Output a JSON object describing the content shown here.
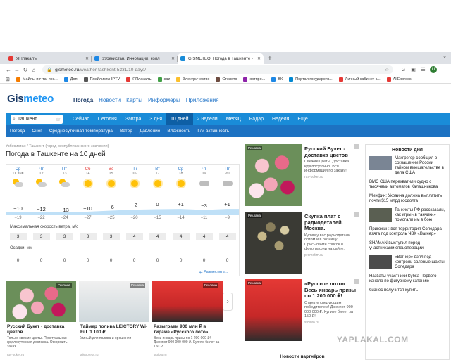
{
  "browser": {
    "tabs": [
      {
        "title": "ЯПлакалъ",
        "color": "#e53935"
      },
      {
        "title": "Узбекистан. Инновации. колл",
        "color": "#1e88e5"
      },
      {
        "title": "GISMETEO: Погода в Ташкенте -",
        "color": "#1a8cd8",
        "active": true
      }
    ],
    "new_tab": "+",
    "url_host": "gismeteo.ru",
    "url_path": "/weather-tashkent-5331/10-days/",
    "avatar": "U",
    "bookmarks": [
      {
        "label": "Майлы почта, пок...",
        "color": "#f57c00"
      },
      {
        "label": "Доп",
        "color": "#1e88e5"
      },
      {
        "label": "Плейлисты IPTV",
        "color": "#555"
      },
      {
        "label": "ЯПлакалъ",
        "color": "#e53935"
      },
      {
        "label": "saz",
        "color": "#43a047"
      },
      {
        "label": "Электричество",
        "color": "#fbc02d"
      },
      {
        "label": "Стелото",
        "color": "#6d4c41"
      },
      {
        "label": "хотпро...",
        "color": "#8e24aa"
      },
      {
        "label": "ВК",
        "color": "#1e88e5"
      },
      {
        "label": "Портал государств...",
        "color": "#0288d1"
      },
      {
        "label": "Личный кабинет к...",
        "color": "#e53935"
      },
      {
        "label": "AliExpress",
        "color": "#e53935"
      }
    ]
  },
  "site": {
    "logo_a": "Gis",
    "logo_b": "meteo",
    "topnav": [
      "Погода",
      "Новости",
      "Карты",
      "Информеры",
      "Приложения"
    ],
    "city": "Ташкент",
    "periods": [
      "Сейчас",
      "Сегодня",
      "Завтра",
      "3 дня",
      "10 дней",
      "2 недели",
      "Месяц",
      "Радар",
      "Неделя",
      "Ещё"
    ],
    "subnav": [
      "Погода",
      "Снег",
      "Среднесуточная температура",
      "Ветер",
      "Давление",
      "Влажность",
      "Г/м активность"
    ],
    "breadcrumb": "Узбекистан / Ташкент (город республиканского значения)",
    "title": "Погода в Ташкенте на 10 дней",
    "placement": "Разместить"
  },
  "forecast": {
    "days": [
      {
        "dn": "Ср",
        "dd": "11 янв",
        "icon": "pc",
        "max": "−10",
        "min": "−19",
        "wind": "3",
        "precip": "0"
      },
      {
        "dn": "Чт",
        "dd": "12",
        "icon": "pc",
        "max": "−12",
        "min": "−22",
        "wind": "3",
        "precip": "0"
      },
      {
        "dn": "Пт",
        "dd": "13",
        "icon": "pc",
        "max": "−13",
        "min": "−24",
        "wind": "3",
        "precip": "0"
      },
      {
        "dn": "Сб",
        "dd": "14",
        "icon": "sun",
        "max": "−10",
        "min": "−27",
        "wind": "3",
        "precip": "0",
        "weekend": true
      },
      {
        "dn": "Вс",
        "dd": "15",
        "icon": "sun",
        "max": "−6",
        "min": "−25",
        "wind": "3",
        "precip": "0",
        "weekend": true
      },
      {
        "dn": "Пн",
        "dd": "16",
        "icon": "sun",
        "max": "−2",
        "min": "−20",
        "wind": "4",
        "precip": "0"
      },
      {
        "dn": "Вт",
        "dd": "17",
        "icon": "sun",
        "max": "0",
        "min": "−15",
        "wind": "4",
        "precip": "0"
      },
      {
        "dn": "Ср",
        "dd": "18",
        "icon": "sun",
        "max": "+1",
        "min": "−14",
        "wind": "4",
        "precip": "0"
      },
      {
        "dn": "Чт",
        "dd": "19",
        "icon": "cloud",
        "max": "−3",
        "min": "−11",
        "wind": "4",
        "precip": "0"
      },
      {
        "dn": "Пт",
        "dd": "20",
        "icon": "cloud",
        "max": "+1",
        "min": "−9",
        "wind": "4",
        "precip": "0"
      }
    ],
    "wind_label": "Максимальная скорость ветра, м/с",
    "precip_label": "Осадки, мм"
  },
  "ads": [
    {
      "badge": "Реклама",
      "title": "Русский Букет - доставка цветов",
      "text": "Свежие цветы. Доставка круглосуточно. Вся информация по заказу!",
      "src": "rus-buket.ru",
      "img": "flowers"
    },
    {
      "badge": "Реклама",
      "title": "Скупка плат с радиодеталей. Москва.",
      "text": "Купим у вас радиодетали оптом и в розницу. Присылайте список и фотографии на сайте.",
      "src": "promotim.ru",
      "img": "parts"
    },
    {
      "badge": "Реклама",
      "title": "«Русское лото»: Весь январь призы по 1 200 000 ₽!",
      "text": "Станьте следующим победителем! Джекпот 900 000 000 ₽. Купите билет за 150 ₽!",
      "src": "stoloto.ru",
      "img": "lotto"
    }
  ],
  "partners_title": "Новости партнёров",
  "bottom_ads": [
    {
      "badge": "Реклама",
      "title": "Русский Букет - доставка цветов",
      "text": "Только свежие цветы. Пунктуальная круглосуточная доставка. Оформить заказ",
      "src": "rus-buket.ru",
      "img": "flowers"
    },
    {
      "badge": "Реклама",
      "title": "Таймер полива LEICTORY Wi-Fi L 1 100 ₽",
      "text": "Умный для полива и орошения",
      "src": "aliexpress.ru",
      "img": "timer"
    },
    {
      "badge": "Реклама",
      "title": "Разыграем 900 млн ₽ в тираже «Русского лото»",
      "text": "Весь январь призы по 1 200 000 ₽! Джекпот 900 000 000 ₽. Купите билет за 150 ₽!",
      "src": "stoloto.ru",
      "img": "lotto"
    }
  ],
  "news": {
    "title": "Новости дня",
    "items": [
      {
        "text": "Макгрегор сообщил о соглашении России тайном вмешательстве в дела США",
        "img": "#7a8594"
      },
      {
        "text": "ВМС США перехватили судно с тысячами автоматов Калашникова",
        "img": ""
      },
      {
        "text": "Минфин: Украина должна выплатить почти $15 млрд госдолга",
        "img": ""
      },
      {
        "text": "Танкисты РФ рассказали, как игры «в танчики» помогали им в бою",
        "img": "#5a5f52"
      },
      {
        "text": "Пригожин: вся территория Соледара взята под контроль ЧВК «Вагнер»",
        "img": ""
      },
      {
        "text": "SHAMAN выступил перед участниками спецоперации",
        "img": ""
      },
      {
        "text": "«Вагнер» взял под контроль солевые шахты Соледара",
        "img": "#4c4c4c"
      },
      {
        "text": "Назваты участники Кубка Первого канала по фигурному катанию",
        "img": ""
      },
      {
        "text": "бизнес получится купить",
        "img": ""
      }
    ]
  },
  "watermark": "YAPLAKAL.COM"
}
